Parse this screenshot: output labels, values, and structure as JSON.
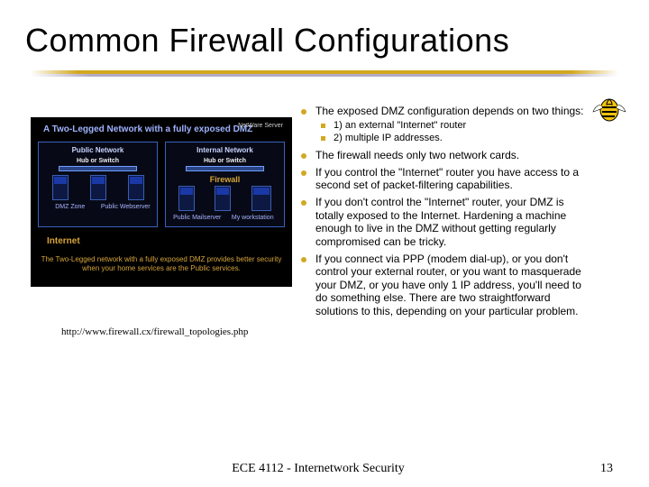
{
  "title": "Common Firewall Configurations",
  "mascot_name": "gt-buzz-mascot",
  "diagram": {
    "title": "A Two-Legged Network with a fully exposed DMZ",
    "netware_server": "NetWare Server",
    "col1_title": "Public Network",
    "col2_title": "Internal Network",
    "hub_label": "Hub or Switch",
    "firewall_label": "Firewall",
    "internet_label": "Internet",
    "col1_below_labels": [
      "DMZ Zone",
      "Public Webserver"
    ],
    "col2_below_labels": [
      "Public Mailserver",
      "My workstation"
    ],
    "caption": "The Two-Legged network with a fully exposed DMZ provides better security when your home services are the Public services."
  },
  "image_source": "http://www.firewall.cx/firewall_topologies.php",
  "bullets": [
    {
      "text": "The exposed DMZ configuration depends on two things:",
      "sub": [
        "1) an external \"Internet\" router",
        "2) multiple IP addresses."
      ]
    },
    {
      "text": "The firewall needs only two network cards."
    },
    {
      "text": "If you control the \"Internet\" router you have access to a second set of packet-filtering capabilities."
    },
    {
      "text": "If you don't control the \"Internet\" router, your DMZ is totally exposed to the Internet. Hardening a machine enough to live in the DMZ without getting regularly compromised can be tricky."
    },
    {
      "text": "If you connect via PPP (modem dial-up), or you don't control your external router, or you want to masquerade your DMZ, or you have only 1 IP address, you'll need to do something else. There are two straightforward solutions to this, depending on your particular problem."
    }
  ],
  "footer": {
    "center": "ECE 4112 - Internetwork Security",
    "page": "13"
  }
}
